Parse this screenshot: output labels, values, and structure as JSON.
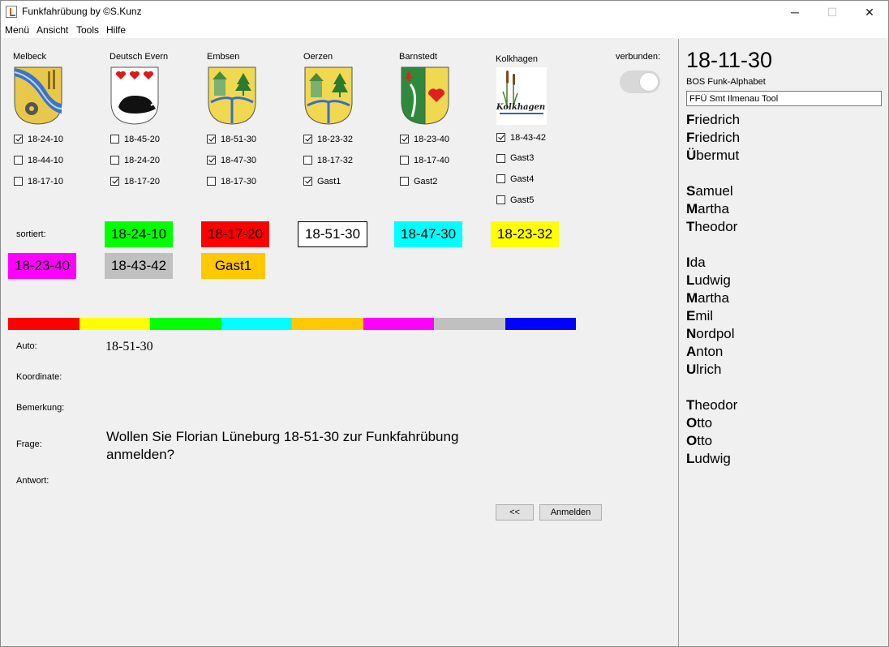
{
  "window": {
    "title": "Funkfahrübung by ©S.Kunz",
    "minimize": "─",
    "maximize": "☐",
    "close": "✕"
  },
  "menu": [
    "Menü",
    "Ansicht",
    "Tools",
    "Hilfe"
  ],
  "towns": [
    {
      "name": "Melbeck",
      "crest": "melbeck-crest-icon",
      "options": [
        {
          "label": "18-24-10",
          "checked": true
        },
        {
          "label": "18-44-10",
          "checked": false
        },
        {
          "label": "18-17-10",
          "checked": false
        }
      ]
    },
    {
      "name": "Deutsch Evern",
      "crest": "deutsch-evern-crest-icon",
      "options": [
        {
          "label": "18-45-20",
          "checked": false
        },
        {
          "label": "18-24-20",
          "checked": false
        },
        {
          "label": "18-17-20",
          "checked": true
        }
      ]
    },
    {
      "name": "Embsen",
      "crest": "embsen-crest-icon",
      "options": [
        {
          "label": "18-51-30",
          "checked": true
        },
        {
          "label": "18-47-30",
          "checked": true
        },
        {
          "label": "18-17-30",
          "checked": false
        }
      ]
    },
    {
      "name": "Oerzen",
      "crest": "oerzen-crest-icon",
      "options": [
        {
          "label": "18-23-32",
          "checked": true
        },
        {
          "label": "18-17-32",
          "checked": false
        },
        {
          "label": "Gast1",
          "checked": true
        }
      ]
    },
    {
      "name": "Barnstedt",
      "crest": "barnstedt-crest-icon",
      "options": [
        {
          "label": "18-23-40",
          "checked": true
        },
        {
          "label": "18-17-40",
          "checked": false
        },
        {
          "label": "Gast2",
          "checked": false
        }
      ]
    },
    {
      "name": "Kolkhagen",
      "crest": "kolkhagen-logo-icon",
      "logo_text": "Kolkhagen",
      "options": [
        {
          "label": "18-43-42",
          "checked": true
        },
        {
          "label": "Gast3",
          "checked": false
        },
        {
          "label": "Gast4",
          "checked": false
        },
        {
          "label": "Gast5",
          "checked": false
        }
      ]
    }
  ],
  "connected_label": "verbunden:",
  "sorted_label": "sortiert:",
  "sorted": [
    {
      "label": "18-24-10",
      "bg": "#00ff00",
      "border": "none"
    },
    {
      "label": "18-17-20",
      "bg": "#ff0000",
      "border": "none"
    },
    {
      "label": "18-51-30",
      "bg": "#ffffff",
      "border": "1px solid #000"
    },
    {
      "label": "18-47-30",
      "bg": "#00ffff",
      "border": "none"
    },
    {
      "label": "18-23-32",
      "bg": "#ffff00",
      "border": "none"
    },
    {
      "label": "18-23-40",
      "bg": "#ff00ff",
      "border": "none"
    },
    {
      "label": "18-43-42",
      "bg": "#c0c0c0",
      "border": "none"
    },
    {
      "label": "Gast1",
      "bg": "#ffc800",
      "border": "none"
    }
  ],
  "colorbar": [
    "#ff0000",
    "#ffff00",
    "#00ff00",
    "#00ffff",
    "#ffc800",
    "#ff00ff",
    "#c0c0c0",
    "#0000ff"
  ],
  "fields": {
    "auto_label": "Auto:",
    "auto_value": "18-51-30",
    "koordinate_label": "Koordinate:",
    "bemerkung_label": "Bemerkung:",
    "frage_label": "Frage:",
    "frage_value": "Wollen Sie Florian Lüneburg 18-51-30 zur Funkfahrübung anmelden?",
    "antwort_label": "Antwort:"
  },
  "buttons": {
    "back": "<<",
    "register": "Anmelden"
  },
  "right_panel": {
    "number": "18-11-30",
    "alphabet_title": "BOS Funk-Alphabet",
    "input_value": "FFÜ Smt Ilmenau Tool",
    "groups": [
      [
        "Friedrich",
        "Friedrich",
        "Übermut"
      ],
      [
        "Samuel",
        "Martha",
        "Theodor"
      ],
      [
        "Ida",
        "Ludwig",
        "Martha",
        "Emil",
        "Nordpol",
        "Anton",
        "Ulrich"
      ],
      [
        "Theodor",
        "Otto",
        "Otto",
        "Ludwig"
      ]
    ]
  }
}
